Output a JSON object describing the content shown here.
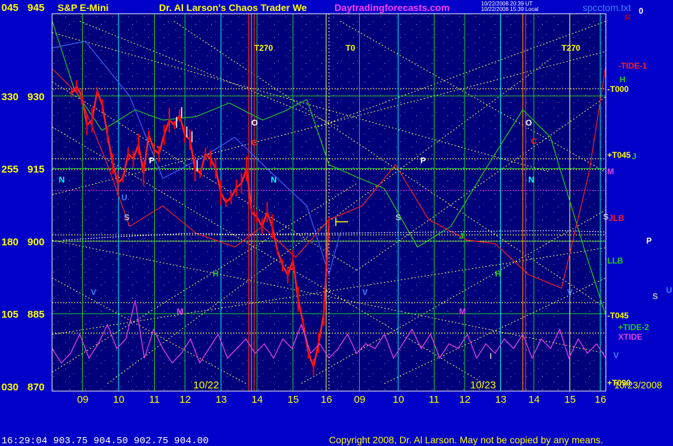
{
  "header": {
    "instrument": "S&P E-Mini",
    "title": "Dr. Al Larson's Chaos Trader We",
    "site": "Daytradingforecasts.com",
    "timestamp_line1": "10/22/2008 20:39 UT",
    "timestamp_line2": "10/22/2008 15:39 Local",
    "file": "spcctom.txt",
    "file_suffix": "0",
    "top_right_letter": "R"
  },
  "footer": {
    "quote": "16:29:04  903.75  904.50  902.75  904.00",
    "copyright": "Copyright 2008, Dr. Al Larson. May not be copied by any means."
  },
  "colors": {
    "background": "#0000c8",
    "price_line": "#ff2020",
    "price_bars": "#ff0000",
    "white_bars": "#ffffff",
    "green_line": "#20d020",
    "xtide": "#e040e0",
    "yellow_grid": "#ffff60",
    "axis_text": "#ffff00",
    "cyan_line": "#00ffff",
    "orange_line": "#ff8000"
  },
  "chart_data": {
    "type": "line",
    "title": "S&P E-Mini",
    "xlabel": "",
    "ylabel": "",
    "y_left_ticks": [
      "045",
      "330",
      "255",
      "180",
      "105",
      "030"
    ],
    "y_ticks": [
      "945",
      "930",
      "915",
      "900",
      "885",
      "870"
    ],
    "ylim": [
      869,
      947
    ],
    "x_hour_labels": [
      "09",
      "10",
      "11",
      "12",
      "13",
      "14",
      "15",
      "16",
      "09",
      "10",
      "11",
      "12",
      "13",
      "14",
      "15",
      "16"
    ],
    "date_labels": [
      "10/22",
      "10/23"
    ],
    "end_date_label": "10/23/2008",
    "right_labels": [
      {
        "text": "-TIDE-1",
        "color": "#ff2020"
      },
      {
        "text": "H",
        "color": "#20d020"
      },
      {
        "text": "-T000",
        "color": "#ffff00"
      },
      {
        "text": "+T045",
        "color": "#ffff00"
      },
      {
        "text": "J",
        "color": "#20d020"
      },
      {
        "text": "M",
        "color": "#e040e0"
      },
      {
        "text": "S",
        "color": "#c0c0c0"
      },
      {
        "text": "JLB",
        "color": "#ff2020"
      },
      {
        "text": "P",
        "color": "#ffffff"
      },
      {
        "text": "LLB",
        "color": "#20d020"
      },
      {
        "text": "S",
        "color": "#c0c0c0"
      },
      {
        "text": "U",
        "color": "#4080ff"
      },
      {
        "text": "-T045",
        "color": "#ffff00"
      },
      {
        "text": "+TIDE-2",
        "color": "#20d020"
      },
      {
        "text": "XTIDE",
        "color": "#e040e0"
      },
      {
        "text": "V",
        "color": "#4080ff"
      },
      {
        "text": "+T090",
        "color": "#ffff00"
      }
    ],
    "time_markers": [
      "T270",
      "T0",
      "T270"
    ],
    "chart_letters": [
      "O",
      "C",
      "P",
      "N",
      "N",
      "J",
      "H",
      "H",
      "M",
      "M",
      "S",
      "S",
      "V",
      "V",
      "V",
      "U",
      "O",
      "C",
      "P",
      "I"
    ],
    "series": [
      {
        "name": "S&P E-Mini",
        "x": [
          0,
          0.02,
          0.04,
          0.06,
          0.08,
          0.1,
          0.12,
          0.14,
          0.16,
          0.18,
          0.2,
          0.22,
          0.24,
          0.26,
          0.28,
          0.3,
          0.32,
          0.34,
          0.36,
          0.38,
          0.4,
          0.42,
          0.44,
          0.46,
          0.48,
          0.5,
          0.52,
          0.54,
          0.56,
          0.58,
          0.6,
          0.62,
          0.64,
          0.66,
          0.68,
          0.7,
          0.72,
          0.74,
          0.76,
          0.78,
          0.8,
          0.82,
          0.84,
          0.86,
          0.88,
          0.9,
          0.92,
          0.94,
          0.96,
          0.98,
          1.0
        ],
        "values": [
          930.5,
          932,
          930,
          924,
          925,
          931,
          928,
          922,
          916,
          912,
          913,
          918,
          917,
          920,
          914,
          922,
          919,
          918,
          922,
          925,
          924,
          926,
          922,
          921,
          915,
          914,
          918,
          917,
          915,
          910,
          908,
          909,
          911,
          912,
          915,
          906,
          905,
          903,
          906,
          903,
          898,
          895,
          893,
          896,
          888,
          883,
          877,
          874,
          879,
          885,
          904
        ]
      },
      {
        "name": "XTIDE",
        "values": [
          876,
          873,
          875,
          879,
          874,
          877,
          881,
          876,
          878,
          886,
          874,
          880,
          876,
          873,
          875,
          878,
          873,
          876,
          879,
          874,
          876,
          878,
          875,
          877,
          874,
          878,
          876,
          881,
          875,
          877,
          874,
          876,
          879,
          875,
          877,
          876,
          879,
          874,
          877,
          880,
          876,
          879,
          874,
          877,
          876,
          879,
          874,
          877,
          875,
          878,
          876,
          879,
          874,
          878,
          876,
          880,
          874,
          878,
          875,
          877,
          874
        ]
      }
    ]
  }
}
